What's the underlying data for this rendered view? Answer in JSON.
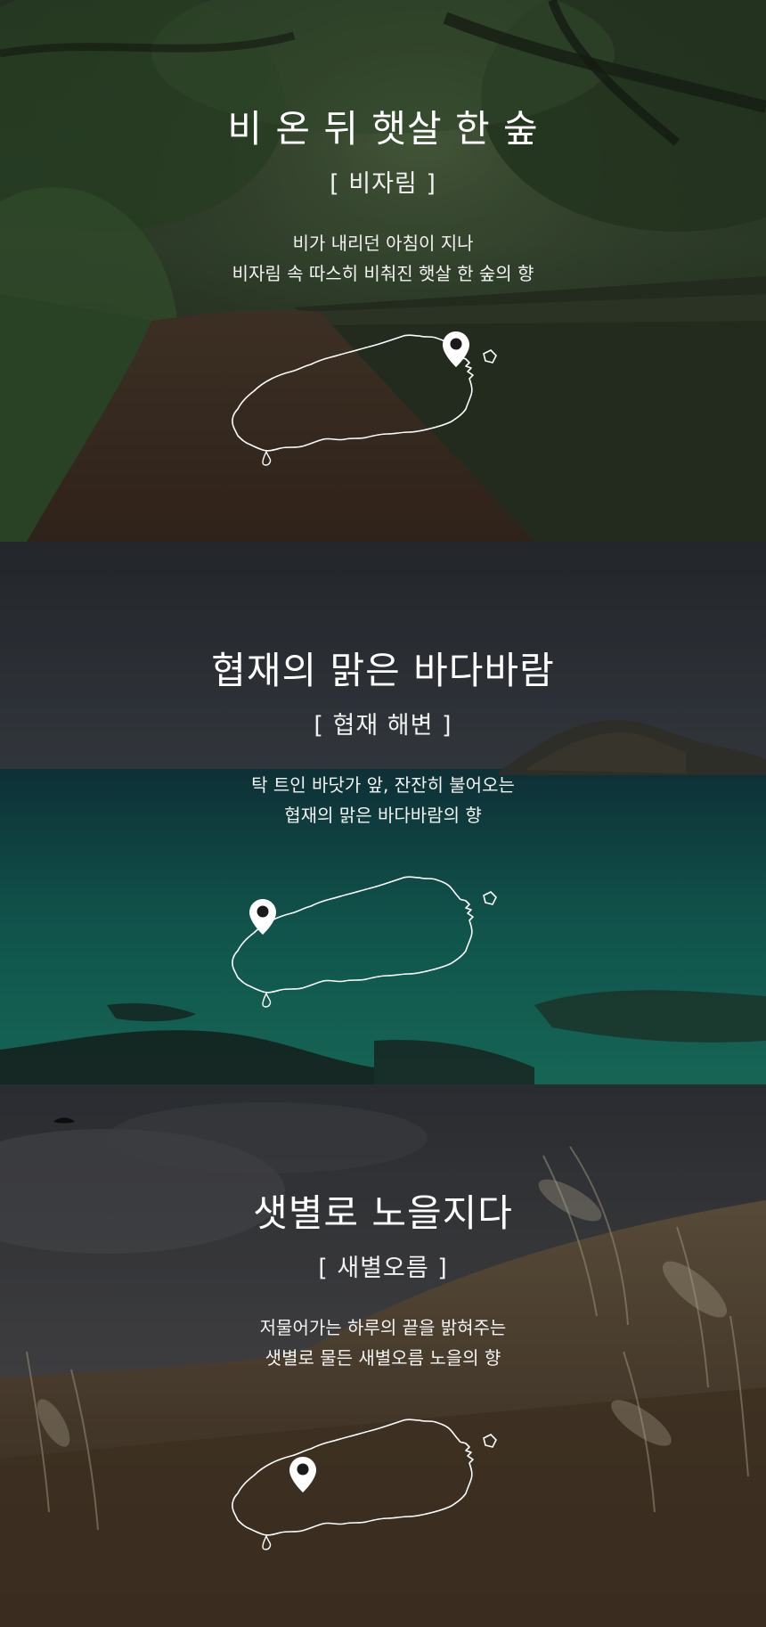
{
  "sections": [
    {
      "title": "비 온 뒤 햇살 한 숲",
      "place": "[ 비자림 ]",
      "desc_line1": "비가 내리던 아침이 지나",
      "desc_line2": "비자림 속 따스히 비춰진 햇살 한 숲의 향",
      "map_icon": "jeju-island-map-icon",
      "pin_icon": "map-pin-icon",
      "scene": "forest-path-with-stone-wall"
    },
    {
      "title": "협재의 맑은 바다바람",
      "place": "[ 협재 해변 ]",
      "desc_line1": "탁 트인 바닷가 앞, 잔잔히 불어오는",
      "desc_line2": "협재의 맑은 바다바람의 향",
      "map_icon": "jeju-island-map-icon",
      "pin_icon": "map-pin-icon",
      "scene": "emerald-sea-with-island"
    },
    {
      "title": "샛별로 노을지다",
      "place": "[ 새별오름 ]",
      "desc_line1": "저물어가는 하루의 끝을 밝혀주는",
      "desc_line2": "샛별로 물든 새별오름 노을의 향",
      "map_icon": "jeju-island-map-icon",
      "pin_icon": "map-pin-icon",
      "scene": "silver-grass-hill-at-dusk"
    }
  ],
  "colors": {
    "text": "#ffffff",
    "forest": "#2f4a2c",
    "sea": "#13605a",
    "sky": "#3a3f46",
    "grass": "#6b5a40"
  }
}
